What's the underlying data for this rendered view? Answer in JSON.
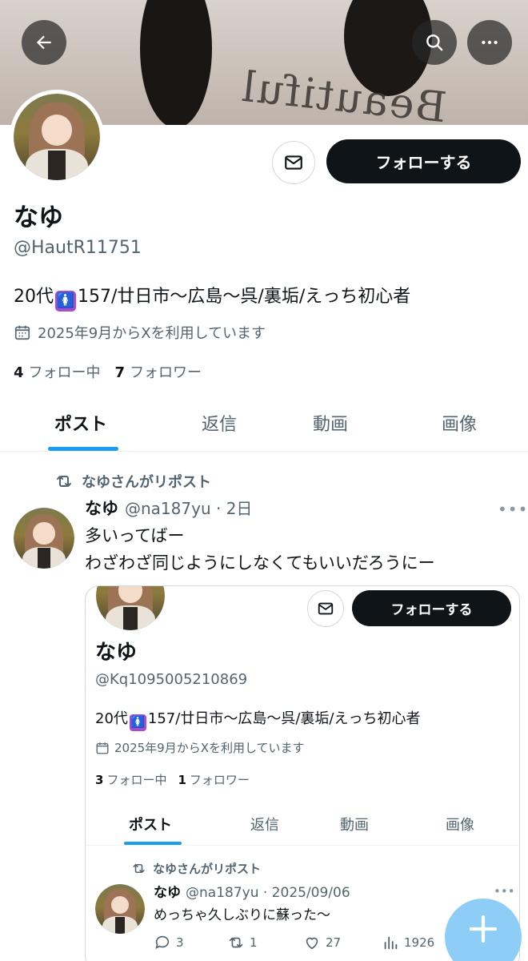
{
  "banner": {
    "print_text": "Beautiful"
  },
  "profile": {
    "name": "なゆ",
    "handle": "@HautR11751",
    "bio_prefix": "20代",
    "bio_emoji": "🚺",
    "bio_suffix": "157/廿日市〜広島〜呉/裏垢/えっち初心者",
    "joined": "2025年9月からXを利用しています",
    "following_count": "4",
    "following_label": "フォロー中",
    "followers_count": "7",
    "followers_label": "フォロワー",
    "follow_label": "フォローする"
  },
  "tabs": [
    {
      "label": "ポスト"
    },
    {
      "label": "返信"
    },
    {
      "label": "動画"
    },
    {
      "label": "画像"
    }
  ],
  "post": {
    "repost_label": "なゆさんがリポスト",
    "author": "なゆ",
    "meta": "@na187yu · 2日",
    "lines": [
      "多いってばー",
      "わざわざ同じようにしなくてもいいだろうにー"
    ],
    "more": "•••"
  },
  "embed": {
    "follow_label": "フォローする",
    "name": "なゆ",
    "handle": "@Kq1095005210869",
    "bio_prefix": "20代",
    "bio_emoji": "🚺",
    "bio_suffix": "157/廿日市〜広島〜呉/裏垢/えっち初心者",
    "joined": "2025年9月からXを利用しています",
    "following_count": "3",
    "following_label": "フォロー中",
    "followers_count": "1",
    "followers_label": "フォロワー",
    "tabs": [
      "ポスト",
      "返信",
      "動画",
      "画像"
    ],
    "repost_label": "なゆさんがリポスト",
    "post_author": "なゆ",
    "post_meta": "@na187yu · 2025/09/06",
    "post_text": "めっちゃ久しぶりに蘇った〜",
    "more": "•••",
    "replies": "3",
    "reposts": "1",
    "likes": "27",
    "views": "1926"
  },
  "colors": {
    "accent": "#1d9bf0",
    "fab": "#8ecdf5",
    "text": "#0f1419",
    "muted": "#536471"
  }
}
